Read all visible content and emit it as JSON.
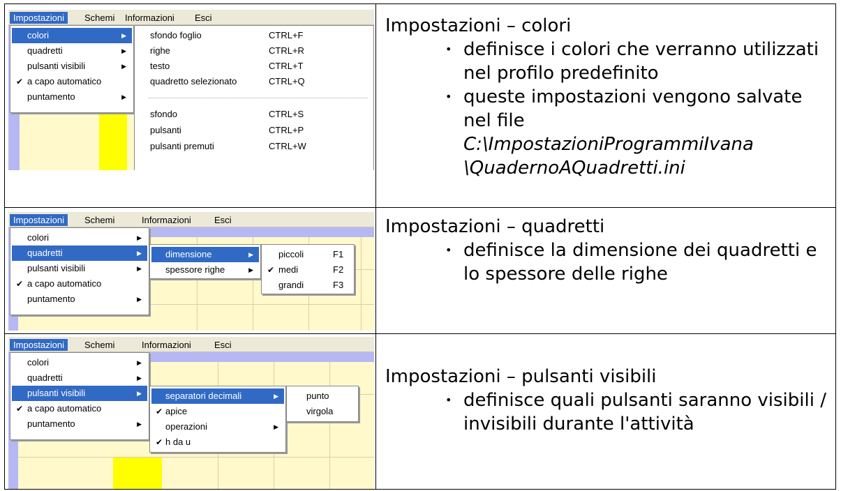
{
  "rows": [
    {
      "screenshot": {
        "menubar": [
          "Impostazioni",
          "Schemi",
          "Informazioni",
          "Esci"
        ],
        "main_menu": [
          "colori",
          "quadretti",
          "pulsanti visibili",
          "a capo automatico",
          "puntamento"
        ],
        "submenu": [
          {
            "label": "sfondo foglio",
            "shortcut": "CTRL+F"
          },
          {
            "label": "righe",
            "shortcut": "CTRL+R"
          },
          {
            "label": "testo",
            "shortcut": "CTRL+T"
          },
          {
            "label": "quadretto selezionato",
            "shortcut": "CTRL+Q"
          },
          {
            "label": "sfondo",
            "shortcut": "CTRL+S"
          },
          {
            "label": "pulsanti",
            "shortcut": "CTRL+P"
          },
          {
            "label": "pulsanti premuti",
            "shortcut": "CTRL+W"
          }
        ]
      },
      "heading": "Impostazioni – colori",
      "bullets": [
        "definisce i colori che verranno utilizzati nel profilo predefinito",
        "queste impostazioni vengono salvate nel file"
      ],
      "path_lines": [
        "C:\\ImpostazioniProgrammiIvana",
        "\\QuadernoAQuadretti.ini"
      ]
    },
    {
      "screenshot": {
        "menubar": [
          "Impostazioni",
          "Schemi",
          "Informazioni",
          "Esci"
        ],
        "main_menu": [
          "colori",
          "quadretti",
          "pulsanti visibili",
          "a capo automatico",
          "puntamento"
        ],
        "submenu": [
          "dimensione",
          "spessore righe"
        ],
        "subsubmenu": [
          {
            "label": "piccoli",
            "shortcut": "F1"
          },
          {
            "label": "medi",
            "shortcut": "F2"
          },
          {
            "label": "grandi",
            "shortcut": "F3"
          }
        ]
      },
      "heading": "Impostazioni – quadretti",
      "bullets": [
        "definisce la dimensione dei quadretti e lo spessore delle righe"
      ]
    },
    {
      "screenshot": {
        "menubar": [
          "Impostazioni",
          "Schemi",
          "Informazioni",
          "Esci"
        ],
        "main_menu": [
          "colori",
          "quadretti",
          "pulsanti visibili",
          "a capo automatico",
          "puntamento"
        ],
        "submenu": [
          "separatori decimali",
          "apice",
          "operazioni",
          "h da u"
        ],
        "subsubmenu": [
          "punto",
          "virgola"
        ]
      },
      "heading": "Impostazioni – pulsanti visibili",
      "bullets": [
        "definisce quali pulsanti saranno visibili / invisibili durante l'attività"
      ]
    }
  ],
  "colors": {
    "selection": "#316ac5",
    "menubar": "#ece9d8",
    "lavender": "#b6b8f4",
    "yellow": "#ffff00",
    "pale_yellow": "#fff9cc"
  },
  "icons": {
    "check": "check-icon",
    "arrow": "submenu-arrow-icon"
  }
}
